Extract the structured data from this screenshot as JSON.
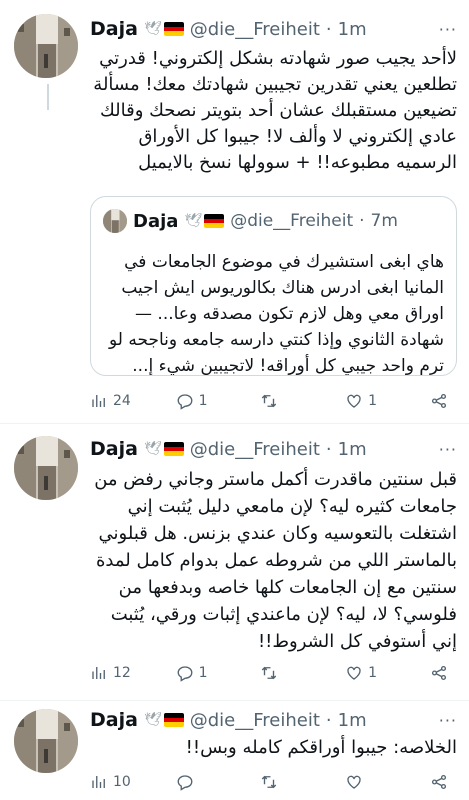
{
  "tweets": [
    {
      "name": "Daja",
      "handle": "@die__Freiheit",
      "time": "1m",
      "text": "لاأحد يجيب صور شهادته بشكل إلكتروني! قدرتي تطلعين يعني تقدرين تجيبين شهادتك معك! مسألة تضيعين مستقبلك عشان أحد بتويتر نصحك وقالك عادي إلكتروني لا وألف لا! جيبوا كل الأوراق الرسميه مطبوعه!! + سوولها نسخ بالايميل",
      "quote": {
        "name": "Daja",
        "handle": "@die__Freiheit",
        "time": "7m",
        "text": "هاي ابغى استشيرك في موضوع الجامعات في المانيا ابغى ادرس هناك بكالوريوس ايش اجيب اوراق معي وهل لازم تكون مصدقه وعا... — شهادة الثانوي وإذا كنتي دارسه جامعه وناجحه لو ترم واحد جيبي كل أوراقه! لاتجيبين شيء إ..."
      },
      "stats": {
        "views": "24",
        "replies": "1",
        "retweets": "",
        "likes": "1"
      }
    },
    {
      "name": "Daja",
      "handle": "@die__Freiheit",
      "time": "1m",
      "text": "قبل سنتين ماقدرت أكمل ماستر وجاني رفض من جامعات كثيره ليه؟ لإن مامعي دليل يُثبت إني اشتغلت بالتعوسيه وكان عندي بزنس. هل قبلوني بالماستر اللي من شروطه عمل بدوام كامل لمدة سنتين مع إن الجامعات كلها خاصه وبدفعها من فلوسي؟ لا، ليه؟ لإن ماعندي إثبات ورقي، يُثبت إني أستوفي كل الشروط!!",
      "stats": {
        "views": "12",
        "replies": "1",
        "retweets": "",
        "likes": "1"
      }
    },
    {
      "name": "Daja",
      "handle": "@die__Freiheit",
      "time": "1m",
      "text": "الخلاصه: جيبوا أوراقكم كامله وبس!!",
      "stats": {
        "views": "10",
        "replies": "",
        "retweets": "",
        "likes": ""
      }
    }
  ],
  "icons": {
    "emoji_dove": "dove-icon",
    "emoji_flag": "germany-flag-icon",
    "more": "more-icon",
    "views": "views-icon",
    "reply": "reply-icon",
    "retweet": "retweet-icon",
    "like": "like-icon",
    "share": "share-icon"
  },
  "colors": {
    "text": "#0f1419",
    "muted": "#536471",
    "border": "#cfd9de",
    "divider": "#eff3f4",
    "flag_black": "#000000",
    "flag_red": "#dd0000",
    "flag_gold": "#ffce00"
  }
}
